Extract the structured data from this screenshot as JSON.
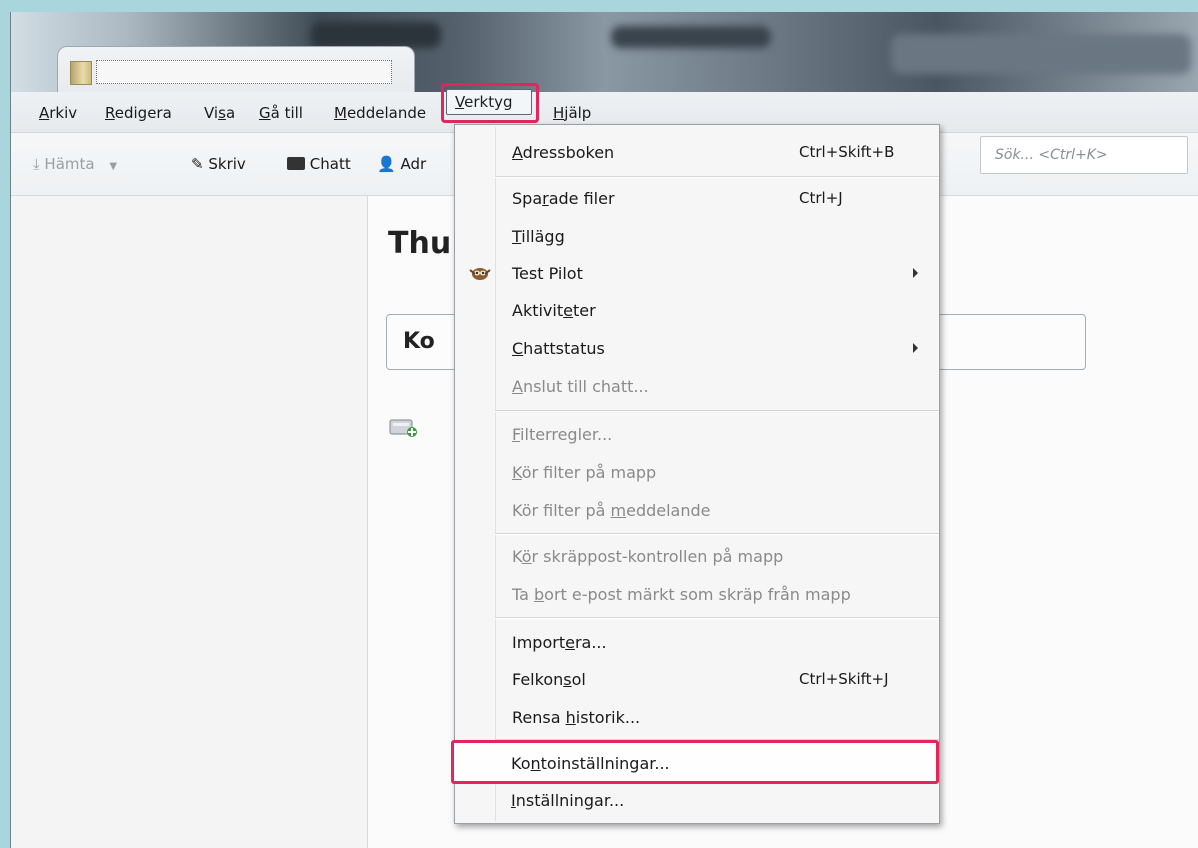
{
  "menubar": {
    "items": [
      {
        "pre": "",
        "u": "A",
        "post": "rkiv"
      },
      {
        "pre": "",
        "u": "R",
        "post": "edigera"
      },
      {
        "pre": "Vi",
        "u": "s",
        "post": "a"
      },
      {
        "pre": "",
        "u": "G",
        "post": "å till"
      },
      {
        "pre": "",
        "u": "M",
        "post": "eddelande"
      },
      {
        "pre": "",
        "u": "V",
        "post": "erktyg"
      },
      {
        "pre": "",
        "u": "H",
        "post": "jälp"
      }
    ]
  },
  "toolbar": {
    "get": "Hämta",
    "write": "Skriv",
    "chat": "Chatt",
    "address": "Adr",
    "search_placeholder": "Sök... <Ctrl+K>"
  },
  "main": {
    "title": "Thu",
    "account_box": "Ko"
  },
  "tools_menu": {
    "items": [
      {
        "pre": "",
        "u": "A",
        "post": "dressboken",
        "shortcut": "Ctrl+Skift+B"
      },
      {
        "pre": "Spa",
        "u": "r",
        "post": "ade filer",
        "shortcut": "Ctrl+J"
      },
      {
        "pre": "",
        "u": "T",
        "post": "illägg",
        "shortcut": ""
      },
      {
        "pre": "Test Pilot",
        "u": "",
        "post": "",
        "shortcut": ""
      },
      {
        "pre": "Aktivit",
        "u": "e",
        "post": "ter",
        "shortcut": ""
      },
      {
        "pre": "",
        "u": "C",
        "post": "hattstatus",
        "shortcut": ""
      },
      {
        "pre": "",
        "u": "A",
        "post": "nslut till chatt...",
        "shortcut": ""
      },
      {
        "pre": "",
        "u": "F",
        "post": "ilterregler...",
        "shortcut": ""
      },
      {
        "pre": "",
        "u": "K",
        "post": "ör filter på mapp",
        "shortcut": ""
      },
      {
        "pre": "Kör filter på ",
        "u": "m",
        "post": "eddelande",
        "shortcut": ""
      },
      {
        "pre": "K",
        "u": "ö",
        "post": "r skräppost-kontrollen på mapp",
        "shortcut": ""
      },
      {
        "pre": "Ta ",
        "u": "b",
        "post": "ort e-post märkt som skräp från mapp",
        "shortcut": ""
      },
      {
        "pre": "Import",
        "u": "e",
        "post": "ra...",
        "shortcut": ""
      },
      {
        "pre": "Felkon",
        "u": "s",
        "post": "ol",
        "shortcut": "Ctrl+Skift+J"
      },
      {
        "pre": "Rensa ",
        "u": "h",
        "post": "istorik...",
        "shortcut": ""
      },
      {
        "pre": "Ko",
        "u": "n",
        "post": "toinställningar...",
        "shortcut": ""
      },
      {
        "pre": "",
        "u": "I",
        "post": "nställningar...",
        "shortcut": ""
      }
    ]
  },
  "colors": {
    "highlight": "#e3245d",
    "background": "#a9d6dc"
  }
}
